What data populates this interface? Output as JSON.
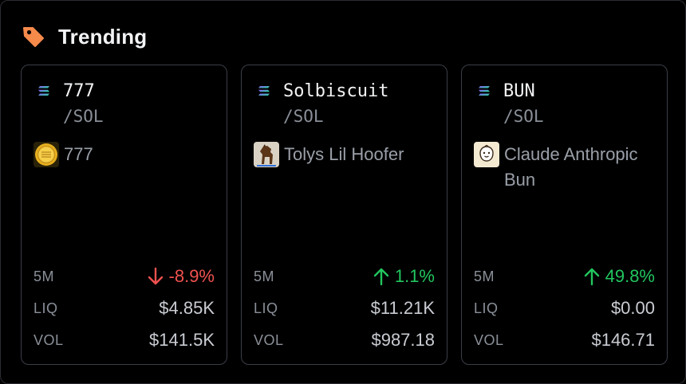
{
  "header": {
    "title": "Trending",
    "icon": "tag-icon",
    "icon_color": "#f58a4b"
  },
  "colors": {
    "positive": "#22c55e",
    "negative": "#f0524f"
  },
  "cards": [
    {
      "symbol": "777",
      "quote": "/SOL",
      "token_name": "777",
      "token_icon": "gold-coin-icon",
      "change_label": "5M",
      "change": "-8.9%",
      "direction": "down",
      "liq_label": "LIQ",
      "liq": "$4.85K",
      "vol_label": "VOL",
      "vol": "$141.5K"
    },
    {
      "symbol": "Solbiscuit",
      "quote": "/SOL",
      "token_name": "Tolys Lil Hoofer",
      "token_icon": "horse-icon",
      "change_label": "5M",
      "change": "1.1%",
      "direction": "up",
      "liq_label": "LIQ",
      "liq": "$11.21K",
      "vol_label": "VOL",
      "vol": "$987.18"
    },
    {
      "symbol": "BUN",
      "quote": "/SOL",
      "token_name": "Claude Anthropic Bun",
      "token_icon": "bun-mascot-icon",
      "change_label": "5M",
      "change": "49.8%",
      "direction": "up",
      "liq_label": "LIQ",
      "liq": "$0.00",
      "vol_label": "VOL",
      "vol": "$146.71"
    }
  ]
}
